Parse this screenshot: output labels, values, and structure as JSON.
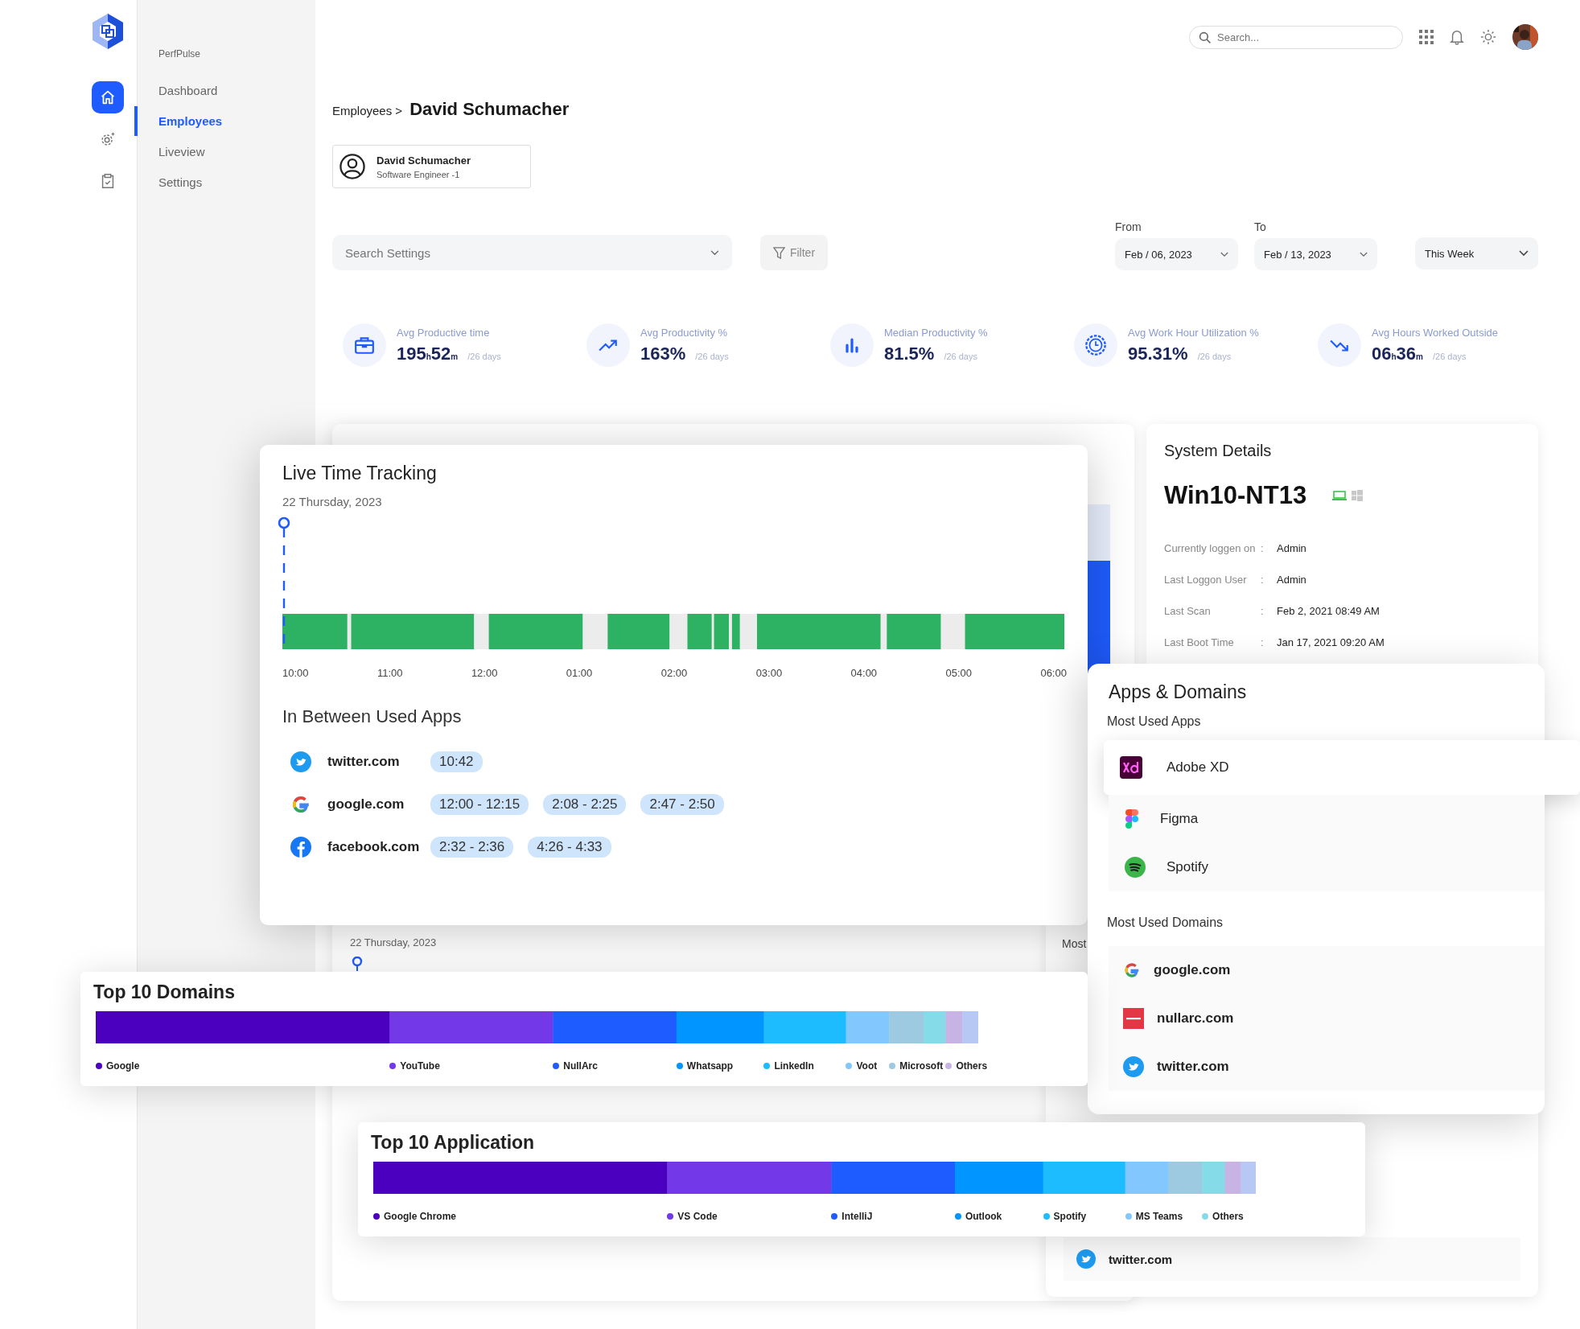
{
  "sidebar": {
    "brand": "PerfPulse",
    "rail": [
      {
        "kind": "home",
        "selected": true
      },
      {
        "kind": "gear",
        "selected": false
      },
      {
        "kind": "clipboard",
        "selected": false
      }
    ],
    "items": [
      {
        "label": "Dashboard",
        "selected": false
      },
      {
        "label": "Employees",
        "selected": true
      },
      {
        "label": "Liveview",
        "selected": false
      },
      {
        "label": "Settings",
        "selected": false
      }
    ]
  },
  "topbar": {
    "search_placeholder": "Search..."
  },
  "breadcrumb": {
    "parent": "Employees >",
    "current": "David Schumacher"
  },
  "profile": {
    "name": "David Schumacher",
    "role": "Software Engineer -1"
  },
  "filters": {
    "search_placeholder": "Search Settings",
    "filter_button": "Filter",
    "from": {
      "label": "From",
      "value": "Feb / 06, 2023"
    },
    "to": {
      "label": "To",
      "value": "Feb  / 13, 2023"
    },
    "range": "This Week"
  },
  "stats": [
    {
      "kind": "briefcase",
      "label": "Avg Productive time",
      "value": "195$_{h}$52$_{m}$",
      "period": "/26 days"
    },
    {
      "kind": "trend-up",
      "label": "Avg Productivity %",
      "value": "163%",
      "period": "/26 days"
    },
    {
      "kind": "bars",
      "label": "Median Productivity %",
      "value": "81.5%",
      "period": "/26 days"
    },
    {
      "kind": "clock",
      "label": "Avg Work Hour Utilization %",
      "value": "95.31%",
      "period": "/26 days"
    },
    {
      "kind": "trend-down",
      "label": "Avg Hours Worked Outside",
      "value": "06$_{h}$36$_{m}$",
      "period": "/26 days"
    }
  ],
  "activity_card": {
    "date": "22 Thursday, 2023"
  },
  "system": {
    "title": "System Details",
    "hostname": "Win10-NT13",
    "rows": [
      {
        "label": "Currently loggen on",
        "separator": ":",
        "value": "Admin"
      },
      {
        "label": "Last Loggon User",
        "separator": ":",
        "value": "Admin"
      },
      {
        "label": "Last Scan",
        "separator": ":",
        "value": "Feb 2, 2021 08:49 AM"
      },
      {
        "label": "Last Boot Time",
        "separator": ":",
        "value": "Jan 17, 2021 09:20 AM"
      }
    ]
  },
  "domains_fragment": {
    "label": "Most",
    "domains": [
      {
        "kind": "twitter",
        "name": "twitter.com"
      }
    ]
  },
  "live_tracking": {
    "title": "Live Time Tracking",
    "date": "22 Thursday, 2023",
    "ticks": [
      "10:00",
      "11:00",
      "12:00",
      "01:00",
      "02:00",
      "03:00",
      "04:00",
      "05:00",
      "06:00"
    ],
    "apps_title": "In Between Used Apps",
    "apps": [
      {
        "kind": "twitter",
        "name": "twitter.com",
        "times": [
          "10:42"
        ]
      },
      {
        "kind": "google",
        "name": "google.com",
        "times": [
          "12:00 - 12:15",
          "2:08 - 2:25",
          "2:47 - 2:50"
        ]
      },
      {
        "kind": "facebook",
        "name": "facebook.com",
        "times": [
          "2:32 - 2:36",
          "4:26 - 4:33"
        ]
      }
    ]
  },
  "apps_domains": {
    "title": "Apps & Domains",
    "apps_title": "Most Used Apps",
    "apps": [
      {
        "kind": "xd",
        "name": "Adobe XD",
        "selected": true
      },
      {
        "kind": "figma",
        "name": "Figma",
        "selected": false
      },
      {
        "kind": "spotify",
        "name": "Spotify",
        "selected": false
      }
    ],
    "domains_title": "Most Used Domains",
    "domains": [
      {
        "kind": "google",
        "name": "google.com"
      },
      {
        "kind": "nullarc",
        "name": "nullarc.com"
      },
      {
        "kind": "twitter",
        "name": "twitter.com"
      }
    ]
  },
  "top_domains": {
    "title": "Top 10 Domains",
    "segments": [
      {
        "name": "Google",
        "color": "#4b00c0"
      },
      {
        "name": "YouTube",
        "color": "#7338e8"
      },
      {
        "name": "NullArc",
        "color": "#1f5cff"
      },
      {
        "name": "Whatsapp",
        "color": "#0095ff"
      },
      {
        "name": "LinkedIn",
        "color": "#1cbcff"
      },
      {
        "name": "Voot",
        "color": "#82c8ff"
      },
      {
        "name": "Microsoft",
        "color": "#9ecae1"
      },
      {
        "color": "#85dbe8"
      },
      {
        "name": "Others",
        "color": "#c8b4e4"
      },
      {
        "color": "#b8c8f5"
      }
    ]
  },
  "top_apps": {
    "title": "Top 10 Application",
    "segments": [
      {
        "name": "Google Chrome",
        "color": "#4b00c0"
      },
      {
        "name": "VS Code",
        "color": "#7338e8"
      },
      {
        "name": "IntelliJ",
        "color": "#1f5cff"
      },
      {
        "name": "Outlook",
        "color": "#0095ff"
      },
      {
        "name": "Spotify",
        "color": "#1cbcff"
      },
      {
        "name": "MS Teams",
        "color": "#82c8ff"
      },
      {
        "color": "#9ecae1"
      },
      {
        "name": "Others",
        "color": "#85dbe8"
      },
      {
        "color": "#c8b4e4"
      },
      {
        "color": "#b8c8f5"
      }
    ]
  }
}
